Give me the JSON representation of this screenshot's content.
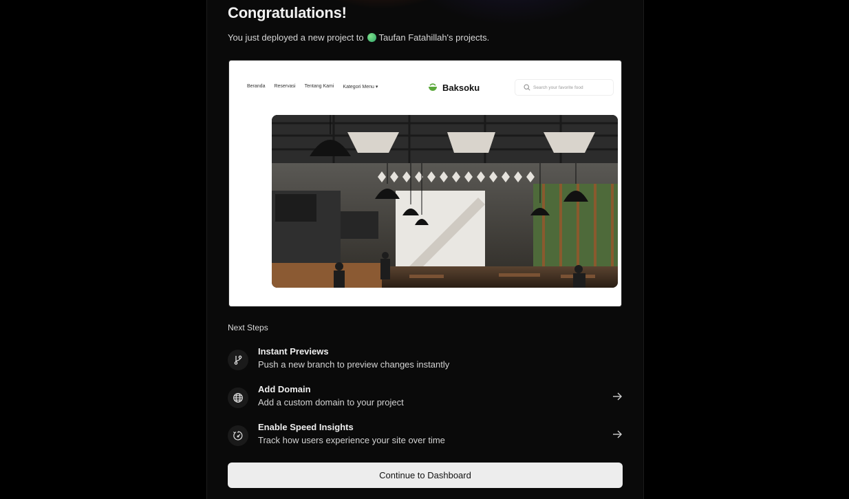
{
  "header": {
    "title": "Congratulations!",
    "subtitle_prefix": "You just deployed a new project to",
    "team_name": "Taufan Fatahillah's projects."
  },
  "preview": {
    "nav_items": [
      "Beranda",
      "Reservasi",
      "Tentang Kami",
      "Kategori Menu ▾"
    ],
    "logo_text": "Baksoku",
    "search_placeholder": "Search your favorite food",
    "hero_image": "cafe-interior-photo"
  },
  "next_steps": {
    "label": "Next Steps",
    "items": [
      {
        "title": "Instant Previews",
        "description": "Push a new branch to preview changes instantly",
        "icon": "git-branch-icon",
        "has_arrow": false
      },
      {
        "title": "Add Domain",
        "description": "Add a custom domain to your project",
        "icon": "globe-icon",
        "has_arrow": true
      },
      {
        "title": "Enable Speed Insights",
        "description": "Track how users experience your site over time",
        "icon": "speed-gauge-icon",
        "has_arrow": true
      }
    ]
  },
  "cta": {
    "label": "Continue to Dashboard"
  },
  "colors": {
    "background": "#000000",
    "panel": "#0a0a0a",
    "button": "#ededed",
    "team_dot": "#3fbf6f"
  }
}
